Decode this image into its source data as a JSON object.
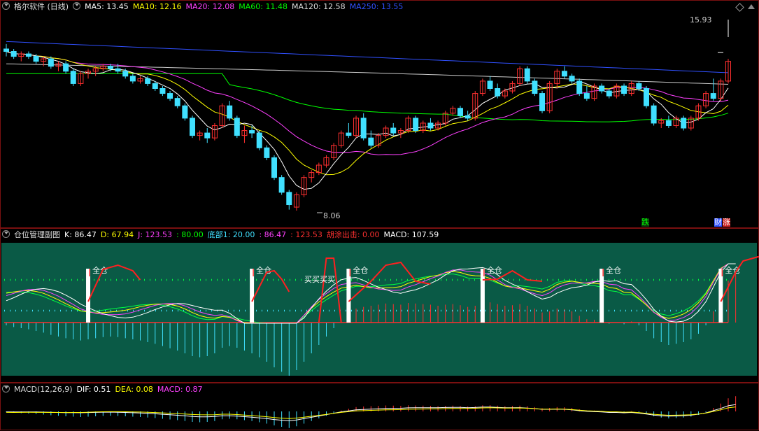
{
  "main": {
    "title": "格尔软件 (日线)",
    "ma": [
      {
        "label": "MA5: 13.45",
        "color": "#ffffff"
      },
      {
        "label": "MA10: 12.16",
        "color": "#ffff00"
      },
      {
        "label": "MA20: 12.08",
        "color": "#ff40ff"
      },
      {
        "label": "MA60: 11.48",
        "color": "#00ff00"
      },
      {
        "label": "MA120: 12.58",
        "color": "#dddddd"
      },
      {
        "label": "MA250: 13.55",
        "color": "#3050ff"
      }
    ],
    "high_label": "15.93",
    "low_label": "8.06",
    "tag_die": "跌",
    "tag_cai": "财",
    "tag_zhang": "涨"
  },
  "position_pane": {
    "title": "仓位管理副图",
    "k": "K: 86.47",
    "d": "D: 67.94",
    "j": "J: 123.53",
    "v80": ": 80.00",
    "bottom": "底部1: 20.00",
    "v2": ": 86.47",
    "v3": ": 123.53",
    "exit": "胡涂出击: 0.00",
    "macd": "MACD: 107.59",
    "signal_label": "全仓",
    "buy_label": "买买买买"
  },
  "macd_pane": {
    "title": "MACD(12,26,9)",
    "dif": "DIF: 0.51",
    "dea": "DEA: 0.08",
    "macd": "MACD: 0.87"
  },
  "colors": {
    "up": "#ff3030",
    "down": "#40e0ff",
    "pane_bg": "#0a5a46",
    "k_line": "#ffffff",
    "d_line": "#ffff00",
    "j_line": "#ff40ff"
  },
  "chart_data": {
    "type": "candlestick",
    "ylim": [
      8.06,
      15.93
    ],
    "candles": [
      [
        14.6,
        14.8,
        14.3,
        14.5
      ],
      [
        14.5,
        14.6,
        14.2,
        14.3
      ],
      [
        14.3,
        14.5,
        14.1,
        14.4
      ],
      [
        14.4,
        14.5,
        14.2,
        14.3
      ],
      [
        14.3,
        14.4,
        14.0,
        14.1
      ],
      [
        14.1,
        14.3,
        13.9,
        14.2
      ],
      [
        14.2,
        14.3,
        13.8,
        13.9
      ],
      [
        13.9,
        14.1,
        13.7,
        14.0
      ],
      [
        14.0,
        14.1,
        13.6,
        13.7
      ],
      [
        13.7,
        13.8,
        13.1,
        13.2
      ],
      [
        13.2,
        13.7,
        13.1,
        13.6
      ],
      [
        13.6,
        13.8,
        13.4,
        13.7
      ],
      [
        13.7,
        13.9,
        13.5,
        13.8
      ],
      [
        13.8,
        14.0,
        13.7,
        13.9
      ],
      [
        13.9,
        14.0,
        13.7,
        13.8
      ],
      [
        13.8,
        14.0,
        13.6,
        13.7
      ],
      [
        13.7,
        13.8,
        13.4,
        13.5
      ],
      [
        13.5,
        13.6,
        13.2,
        13.3
      ],
      [
        13.3,
        13.5,
        13.2,
        13.4
      ],
      [
        13.4,
        13.5,
        13.1,
        13.2
      ],
      [
        13.2,
        13.3,
        12.9,
        13.0
      ],
      [
        13.0,
        13.1,
        12.7,
        12.8
      ],
      [
        12.8,
        12.9,
        12.5,
        12.6
      ],
      [
        12.6,
        12.7,
        12.2,
        12.3
      ],
      [
        12.3,
        12.4,
        11.7,
        11.8
      ],
      [
        11.8,
        11.9,
        11.0,
        11.1
      ],
      [
        11.1,
        11.3,
        10.9,
        11.2
      ],
      [
        11.2,
        11.4,
        10.8,
        11.0
      ],
      [
        11.0,
        11.6,
        10.9,
        11.5
      ],
      [
        11.5,
        12.4,
        11.4,
        12.3
      ],
      [
        12.3,
        12.5,
        11.7,
        11.8
      ],
      [
        11.8,
        11.9,
        11.0,
        11.1
      ],
      [
        11.1,
        11.5,
        10.8,
        11.3
      ],
      [
        11.3,
        11.5,
        11.0,
        11.2
      ],
      [
        11.2,
        11.3,
        10.5,
        10.6
      ],
      [
        10.6,
        10.7,
        10.1,
        10.2
      ],
      [
        10.2,
        10.3,
        9.3,
        9.4
      ],
      [
        9.4,
        9.5,
        8.7,
        8.8
      ],
      [
        8.8,
        8.9,
        8.1,
        8.3
      ],
      [
        8.2,
        8.8,
        8.06,
        8.7
      ],
      [
        8.7,
        9.5,
        8.6,
        9.4
      ],
      [
        9.4,
        9.7,
        9.2,
        9.6
      ],
      [
        9.6,
        10.0,
        9.5,
        9.9
      ],
      [
        9.9,
        10.3,
        9.8,
        10.2
      ],
      [
        10.2,
        10.8,
        10.1,
        10.7
      ],
      [
        10.7,
        11.3,
        10.6,
        11.2
      ],
      [
        11.2,
        11.6,
        11.0,
        11.1
      ],
      [
        11.1,
        11.9,
        11.0,
        11.8
      ],
      [
        11.8,
        12.0,
        10.9,
        11.0
      ],
      [
        11.0,
        11.3,
        10.6,
        10.7
      ],
      [
        10.7,
        11.2,
        10.6,
        11.1
      ],
      [
        11.1,
        11.5,
        11.0,
        11.4
      ],
      [
        11.4,
        11.6,
        11.1,
        11.2
      ],
      [
        11.2,
        11.4,
        11.0,
        11.3
      ],
      [
        11.3,
        11.9,
        11.2,
        11.8
      ],
      [
        11.8,
        11.9,
        11.2,
        11.3
      ],
      [
        11.3,
        11.7,
        11.2,
        11.6
      ],
      [
        11.6,
        11.8,
        11.3,
        11.4
      ],
      [
        11.4,
        11.7,
        11.3,
        11.6
      ],
      [
        11.6,
        12.1,
        11.5,
        12.0
      ],
      [
        12.0,
        12.3,
        11.9,
        12.2
      ],
      [
        12.2,
        12.3,
        11.8,
        11.9
      ],
      [
        11.9,
        12.1,
        11.7,
        11.8
      ],
      [
        11.8,
        12.9,
        11.7,
        12.8
      ],
      [
        12.8,
        13.4,
        12.7,
        13.3
      ],
      [
        13.3,
        13.5,
        12.9,
        13.0
      ],
      [
        13.0,
        13.2,
        12.6,
        12.7
      ],
      [
        12.7,
        13.0,
        12.6,
        12.9
      ],
      [
        12.9,
        13.3,
        12.8,
        13.2
      ],
      [
        13.2,
        13.9,
        13.1,
        13.8
      ],
      [
        13.8,
        13.9,
        13.2,
        13.3
      ],
      [
        13.3,
        13.4,
        12.7,
        12.8
      ],
      [
        12.8,
        12.9,
        12.0,
        12.1
      ],
      [
        12.1,
        13.3,
        12.0,
        13.2
      ],
      [
        13.2,
        13.8,
        13.0,
        13.7
      ],
      [
        13.7,
        13.9,
        13.4,
        13.5
      ],
      [
        13.5,
        13.6,
        13.2,
        13.3
      ],
      [
        13.3,
        13.4,
        12.7,
        12.8
      ],
      [
        12.8,
        13.1,
        12.5,
        12.6
      ],
      [
        12.6,
        13.2,
        12.5,
        13.1
      ],
      [
        13.1,
        13.2,
        12.8,
        12.9
      ],
      [
        12.9,
        13.0,
        12.6,
        12.7
      ],
      [
        12.7,
        13.2,
        12.6,
        13.1
      ],
      [
        13.1,
        13.2,
        12.7,
        12.8
      ],
      [
        12.8,
        13.3,
        12.7,
        13.2
      ],
      [
        13.2,
        13.3,
        12.9,
        13.0
      ],
      [
        13.0,
        13.1,
        12.2,
        12.3
      ],
      [
        12.3,
        12.4,
        11.5,
        11.6
      ],
      [
        11.6,
        11.8,
        11.4,
        11.7
      ],
      [
        11.7,
        11.9,
        11.4,
        11.5
      ],
      [
        11.5,
        11.9,
        11.4,
        11.8
      ],
      [
        11.8,
        11.9,
        11.3,
        11.4
      ],
      [
        11.4,
        11.9,
        11.3,
        11.8
      ],
      [
        11.8,
        12.4,
        11.7,
        12.3
      ],
      [
        12.3,
        12.9,
        12.2,
        12.8
      ],
      [
        12.8,
        13.4,
        12.5,
        12.6
      ],
      [
        12.6,
        13.4,
        12.5,
        13.3
      ],
      [
        13.3,
        14.2,
        13.2,
        14.1
      ]
    ],
    "macd_hist": [
      -0.05,
      -0.08,
      -0.1,
      -0.12,
      -0.15,
      -0.18,
      -0.22,
      -0.25,
      -0.28,
      -0.3,
      -0.32,
      -0.3,
      -0.28,
      -0.26,
      -0.25,
      -0.26,
      -0.28,
      -0.3,
      -0.32,
      -0.35,
      -0.38,
      -0.42,
      -0.46,
      -0.5,
      -0.55,
      -0.6,
      -0.62,
      -0.6,
      -0.55,
      -0.45,
      -0.42,
      -0.45,
      -0.5,
      -0.55,
      -0.62,
      -0.7,
      -0.8,
      -0.88,
      -0.95,
      -0.85,
      -0.7,
      -0.55,
      -0.4,
      -0.25,
      -0.1,
      0.05,
      0.15,
      0.25,
      0.28,
      0.3,
      0.32,
      0.34,
      0.33,
      0.32,
      0.35,
      0.34,
      0.33,
      0.32,
      0.3,
      0.32,
      0.33,
      0.31,
      0.28,
      0.3,
      0.35,
      0.36,
      0.33,
      0.3,
      0.31,
      0.33,
      0.3,
      0.25,
      0.18,
      0.2,
      0.25,
      0.24,
      0.2,
      0.12,
      0.06,
      0.05,
      0.03,
      -0.02,
      0.0,
      -0.03,
      0.02,
      -0.05,
      -0.15,
      -0.28,
      -0.35,
      -0.4,
      -0.38,
      -0.35,
      -0.3,
      -0.2,
      -0.05,
      0.2,
      0.45,
      0.75,
      0.87
    ]
  }
}
